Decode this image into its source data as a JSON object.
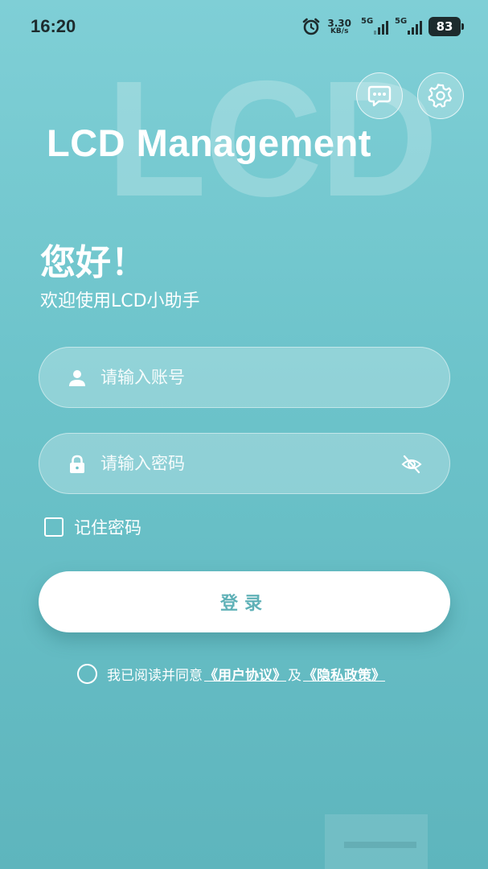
{
  "status_bar": {
    "time": "16:20",
    "net_speed_value": "3.30",
    "net_speed_unit": "KB/s",
    "signal1_label": "5G",
    "signal2_label": "5G",
    "battery": "83",
    "icons": [
      "alarm-icon",
      "signal-icon",
      "battery-icon"
    ]
  },
  "header": {
    "watermark": "LCD",
    "title": "LCD Management",
    "buttons": [
      {
        "icon": "chat-bubble-icon"
      },
      {
        "icon": "gear-icon"
      }
    ]
  },
  "greeting": {
    "title": "您好！",
    "subtitle": "欢迎使用LCD小助手"
  },
  "form": {
    "account": {
      "placeholder": "请输入账号",
      "value": "",
      "icon": "user-icon"
    },
    "password": {
      "placeholder": "请输入密码",
      "value": "",
      "icon": "lock-icon",
      "toggle_icon": "eye-off-icon"
    },
    "remember_label": "记住密码",
    "remember_checked": false,
    "login_label": "登录"
  },
  "agreement": {
    "checked": false,
    "prefix": "我已阅读并同意",
    "user_agreement": "《用户协议》",
    "conjunction": "及",
    "privacy_policy": "《隐私政策》"
  },
  "colors": {
    "background_top": "#7fcfd6",
    "background_bottom": "#5eb5bd",
    "accent": "#5fb1b7",
    "status_text": "#1d2b2d"
  }
}
